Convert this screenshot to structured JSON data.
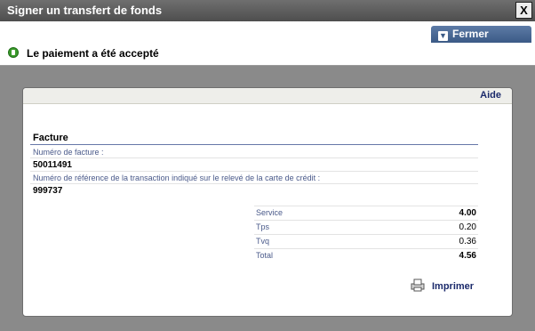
{
  "window": {
    "title": "Signer un transfert de fonds",
    "close_label": "X"
  },
  "toolbar": {
    "close_button_label": "Fermer"
  },
  "status": {
    "message": "Le paiement a été accepté"
  },
  "panel": {
    "help_label": "Aide",
    "section_title": "Facture",
    "fields": [
      {
        "label": "Numéro de facture :",
        "value": "50011491"
      },
      {
        "label": "Numéro de référence de la transaction indiqué sur le relevé de la carte de crédit :",
        "value": "999737"
      }
    ],
    "summary": [
      {
        "label": "Service",
        "value": "4.00",
        "bold": true
      },
      {
        "label": "Tps",
        "value": "0.20",
        "bold": false
      },
      {
        "label": "Tvq",
        "value": "0.36",
        "bold": false
      },
      {
        "label": "Total",
        "value": "4.56",
        "bold": true
      }
    ],
    "print_label": "Imprimer"
  },
  "colors": {
    "accent": "#3b5a86",
    "link": "#1b2a6b",
    "success": "#3a9a2a"
  }
}
